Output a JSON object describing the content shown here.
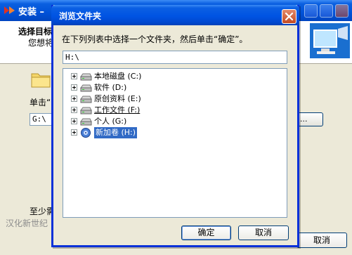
{
  "background_window": {
    "title": "安装 –",
    "header_title": "选择目标",
    "header_subtitle": "您想将",
    "click_label": "单击“",
    "path_value": "G:\\",
    "browse_label": "...",
    "space_label": "至少需",
    "brand": "汉化新世纪",
    "cancel_label": "取消"
  },
  "dialog": {
    "title": "浏览文件夹",
    "instruction": "在下列列表中选择一个文件夹，然后单击“确定”。",
    "path_value": "H:\\",
    "tree": [
      {
        "label": "本地磁盘 (C:)",
        "icon": "hard-drive-icon",
        "selected": false,
        "underline": false
      },
      {
        "label": "软件 (D:)",
        "icon": "hard-drive-icon",
        "selected": false,
        "underline": false
      },
      {
        "label": "原创资料 (E:)",
        "icon": "hard-drive-icon",
        "selected": false,
        "underline": false
      },
      {
        "label": "工作文件 (F:)",
        "icon": "hard-drive-icon",
        "selected": false,
        "underline": true
      },
      {
        "label": "个人 (G:)",
        "icon": "hard-drive-icon",
        "selected": false,
        "underline": false
      },
      {
        "label": "新加卷 (H:)",
        "icon": "disc-drive-icon",
        "selected": true,
        "underline": false
      }
    ],
    "ok_label": "确定",
    "cancel_label": "取消"
  },
  "colors": {
    "titlebar_blue": "#0054e3",
    "selection_blue": "#316ac5",
    "dialog_face": "#ece9d8"
  }
}
